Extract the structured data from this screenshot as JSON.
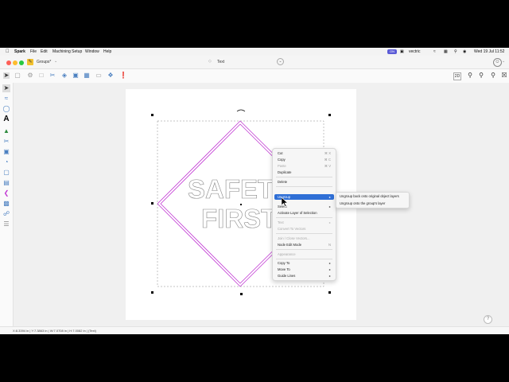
{
  "menubar": {
    "app": "Spark",
    "items": [
      "File",
      "Edit",
      "Machining Setup",
      "Window",
      "Help"
    ],
    "status_badge": "ON",
    "user": "vectric",
    "clock": "Wed 19 Jul 11:52"
  },
  "titlebar": {
    "doc_name": "Groups*",
    "center_title": "Text"
  },
  "statusbar": {
    "text": "X:8.3394 in | Y:7.3863 in | W:7.0708 in | H:7.0082 in | (Text)"
  },
  "artwork": {
    "line1": "SAFETY",
    "line2": "FIRST"
  },
  "context_menu": {
    "items": [
      {
        "label": "Cut",
        "shortcut": "⌘ X"
      },
      {
        "label": "Copy",
        "shortcut": "⌘ C"
      },
      {
        "label": "Paste",
        "shortcut": "⌘ V",
        "disabled": true
      },
      {
        "label": "Duplicate"
      },
      {
        "label": "Delete"
      },
      {
        "label": "Ungroup",
        "highlighted": true
      },
      {
        "label": "Select"
      },
      {
        "label": "Activate Layer of Selection"
      },
      {
        "label": "Text",
        "disabled": true
      },
      {
        "label": "Convert To Vectors",
        "disabled": true
      },
      {
        "label": "Join / Close Vectors...",
        "disabled": true
      },
      {
        "label": "Node Edit Mode",
        "shortcut": "N"
      },
      {
        "label": "Appearance",
        "disabled": true
      },
      {
        "label": "Copy To"
      },
      {
        "label": "Move To"
      },
      {
        "label": "Guide Lines"
      }
    ]
  },
  "submenu": {
    "items": [
      "Ungroup back onto original object layers",
      "Ungroup onto the group's layer"
    ]
  },
  "colors": {
    "accent": "#2f6fd6",
    "magenta": "#c23bd4",
    "traffic_red": "#fe5f57",
    "traffic_yellow": "#febc2e",
    "traffic_green": "#28c840"
  }
}
